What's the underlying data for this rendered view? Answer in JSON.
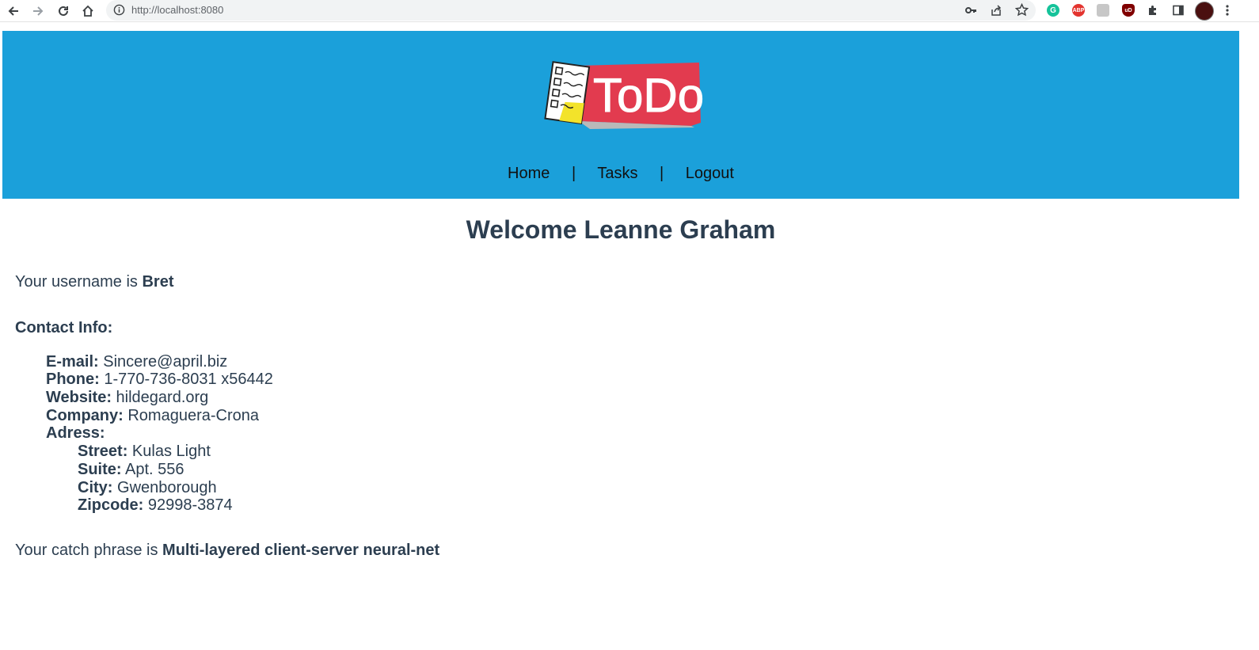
{
  "browser": {
    "url": "http://localhost:8080",
    "icons": [
      "back-icon",
      "forward-icon",
      "reload-icon",
      "home-icon",
      "info-icon",
      "key-icon",
      "share-icon",
      "star-icon",
      "grammarly-icon",
      "adblock-icon",
      "extension-icon",
      "ublock-icon",
      "puzzle-icon",
      "sidepanel-icon",
      "profile-avatar",
      "menu-icon"
    ],
    "ext_labels": {
      "adblock": "ABP",
      "ublock": "uD"
    }
  },
  "header": {
    "logo_text": "ToDo",
    "background": "#1ba0da",
    "nav": [
      {
        "label": "Home"
      },
      {
        "label": "Tasks"
      },
      {
        "label": "Logout"
      }
    ],
    "separator": "|"
  },
  "main": {
    "welcome": "Welcome Leanne Graham",
    "username_prefix": "Your username is ",
    "username": "Bret",
    "contact_heading": "Contact Info:",
    "contact": [
      {
        "label": "E-mail:",
        "value": "Sincere@april.biz"
      },
      {
        "label": "Phone:",
        "value": "1-770-736-8031 x56442"
      },
      {
        "label": "Website:",
        "value": "hildegard.org"
      },
      {
        "label": "Company:",
        "value": "Romaguera-Crona"
      }
    ],
    "address_label": "Adress:",
    "address": [
      {
        "label": "Street:",
        "value": "Kulas Light"
      },
      {
        "label": "Suite:",
        "value": "Apt. 556"
      },
      {
        "label": "City:",
        "value": "Gwenborough"
      },
      {
        "label": "Zipcode:",
        "value": "92998-3874"
      }
    ],
    "catch_prefix": "Your catch phrase is ",
    "catch_phrase": "Multi-layered client-server neural-net"
  }
}
